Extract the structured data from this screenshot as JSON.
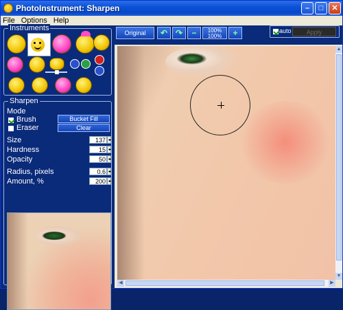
{
  "window": {
    "title": "PhotoInstrument: Sharpen"
  },
  "menu": [
    "File",
    "Options",
    "Help"
  ],
  "instruments": {
    "group_title": "Instruments"
  },
  "sharpen": {
    "group_title": "Sharpen",
    "mode_label": "Mode",
    "brush_label": "Brush",
    "eraser_label": "Eraser",
    "brush_checked": true,
    "eraser_checked": false,
    "bucket_fill_label": "Bucket Fill",
    "clear_label": "Clear",
    "size_label": "Size",
    "size_value": "137",
    "hardness_label": "Hardness",
    "hardness_value": "15",
    "opacity_label": "Opacity",
    "opacity_value": "50",
    "radius_label": "Radius, pixels",
    "radius_value": "0.6",
    "amount_label": "Amount, %",
    "amount_value": "200"
  },
  "toolbar": {
    "original_label": "Original",
    "zoom_top": "100%",
    "zoom_bottom": "100%",
    "auto_label": "auto",
    "auto_checked": true,
    "apply_label": "Apply"
  }
}
